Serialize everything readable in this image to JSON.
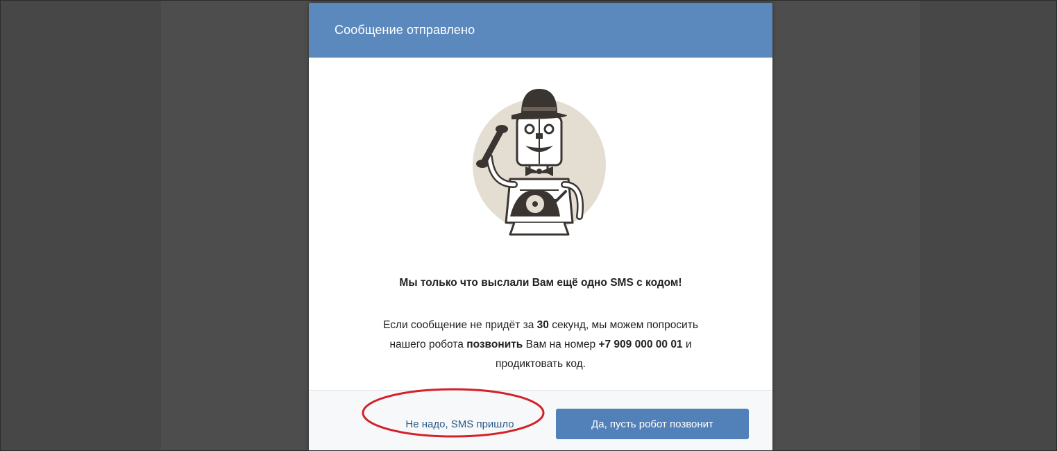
{
  "dialog": {
    "title": "Сообщение отправлено",
    "headline": "Мы только что выслали Вам ещё одно SMS с кодом!",
    "body": {
      "part1": "Если сообщение не придёт за ",
      "seconds": "30",
      "part2": " секунд, мы можем попросить",
      "part3": "нашего робота ",
      "call_word": "позвонить",
      "part4": " Вам на номер ",
      "phone": "+7 909 000 00 01",
      "part5": " и",
      "part6": "продиктовать код."
    },
    "buttons": {
      "decline_label": "Не надо, SMS пришло",
      "accept_label": "Да, пусть робот позвонит"
    }
  },
  "illustration": {
    "icon": "robot-with-telephone-illustration"
  },
  "annotation": {
    "icon": "red-ellipse-highlight",
    "color": "#d42027"
  },
  "colors": {
    "header": "#5b88bd",
    "primary_button": "#5181b8",
    "link": "#2a5885",
    "backdrop": "#474747"
  }
}
